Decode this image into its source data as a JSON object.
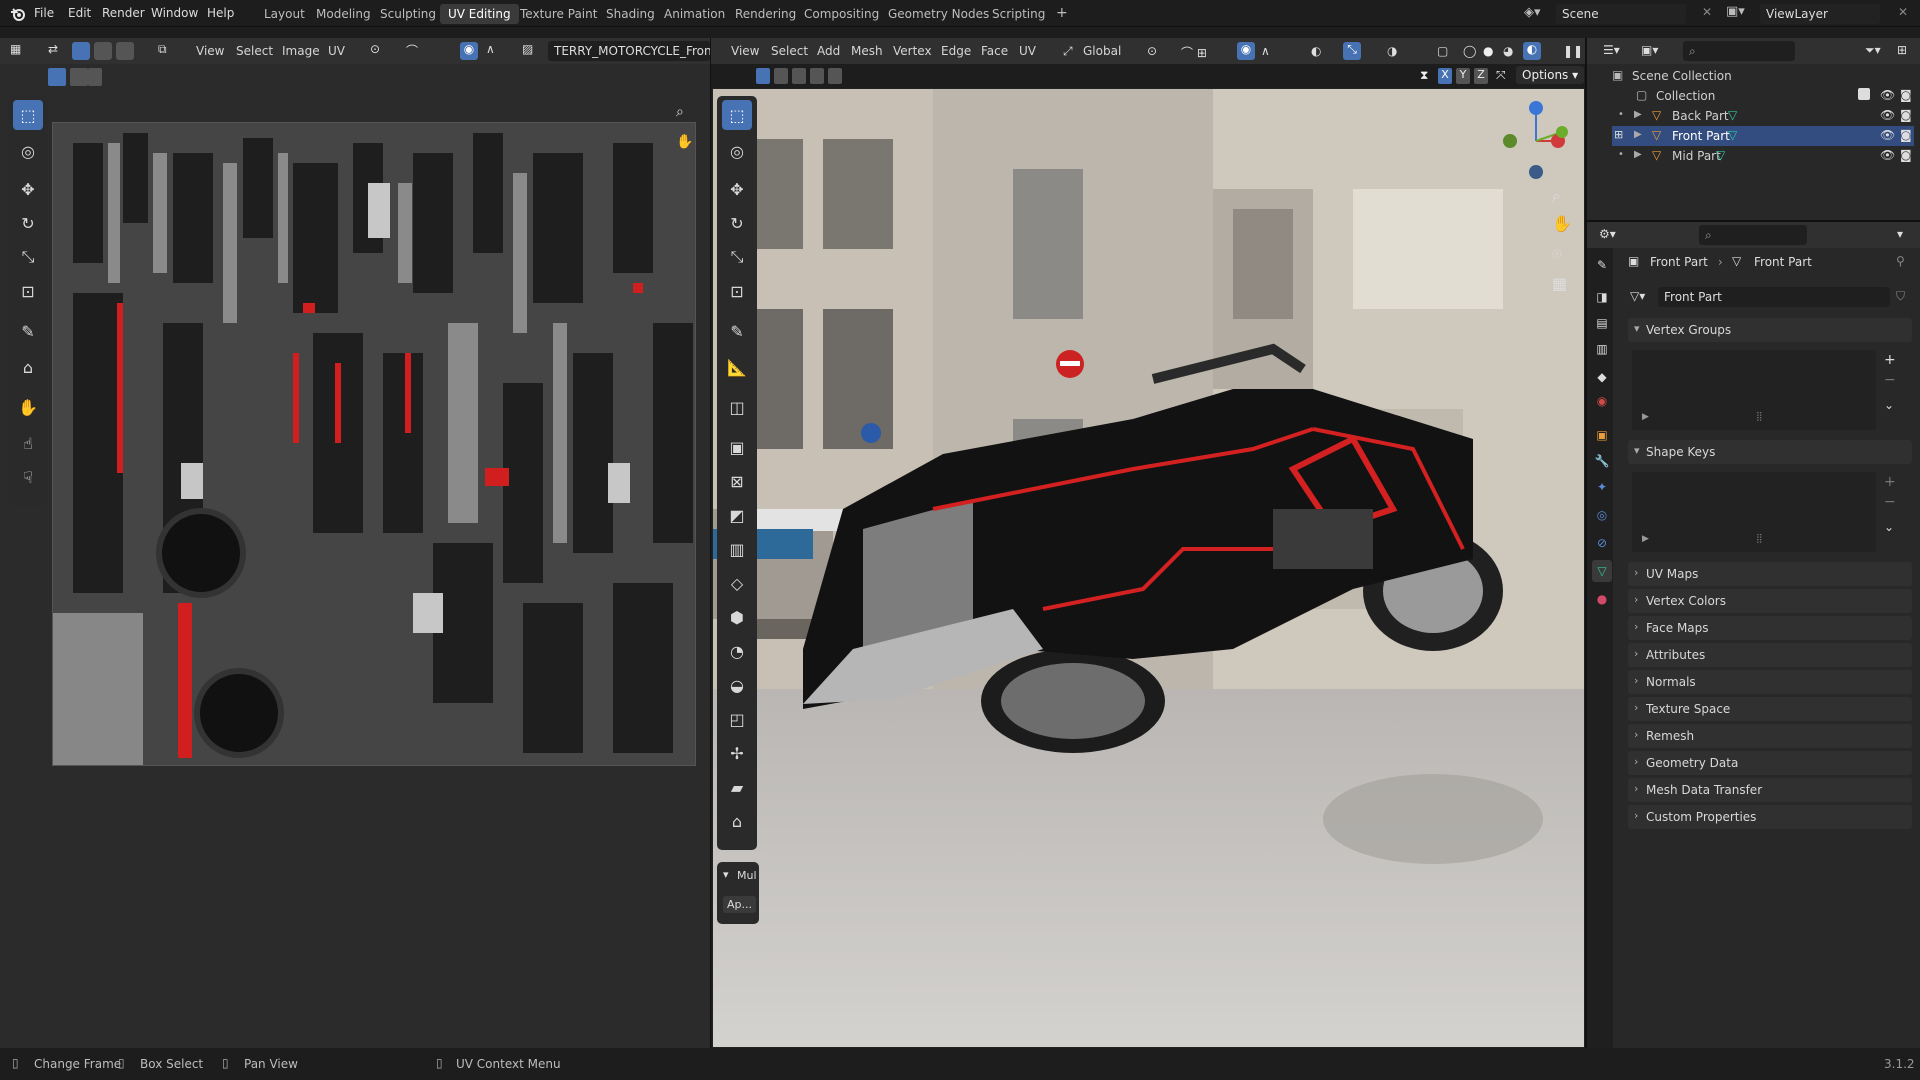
{
  "menus": [
    "File",
    "Edit",
    "Render",
    "Window",
    "Help"
  ],
  "workspaces": [
    "Layout",
    "Modeling",
    "Sculpting",
    "UV Editing",
    "Texture Paint",
    "Shading",
    "Animation",
    "Rendering",
    "Compositing",
    "Geometry Nodes",
    "Scripting"
  ],
  "active_workspace": "UV Editing",
  "scene_name": "Scene",
  "view_layer": "ViewLayer",
  "uv_editor": {
    "menus": [
      "View",
      "Select",
      "Image",
      "UV"
    ],
    "image_name": "TERRY_MOTORCYCLE_Front Pa"
  },
  "viewport": {
    "menus": [
      "View",
      "Select",
      "Add",
      "Mesh",
      "Vertex",
      "Edge",
      "Face",
      "UV"
    ],
    "transform_orientation": "Global",
    "axis_labels": [
      "X",
      "Y",
      "Z"
    ],
    "options_label": "Options",
    "last_op_label": "Mul",
    "last_op_button": "Ap..."
  },
  "outliner": {
    "scene_collection": "Scene Collection",
    "collection": "Collection",
    "items": [
      {
        "label": "Back Part",
        "selected": false
      },
      {
        "label": "Front Part",
        "selected": true
      },
      {
        "label": "Mid Part",
        "selected": false
      }
    ]
  },
  "properties": {
    "breadcrumb_object": "Front Part",
    "breadcrumb_data": "Front Part",
    "mesh_name": "Front Part",
    "vertex_groups": "Vertex Groups",
    "shape_keys": "Shape Keys",
    "panels": [
      "UV Maps",
      "Vertex Colors",
      "Face Maps",
      "Attributes",
      "Normals",
      "Texture Space",
      "Remesh",
      "Geometry Data",
      "Mesh Data Transfer",
      "Custom Properties"
    ]
  },
  "status": {
    "change_frame": "Change Frame",
    "box_select": "Box Select",
    "pan_view": "Pan View",
    "uv_context_menu": "UV Context Menu",
    "version": "3.1.2"
  },
  "colors": {
    "accent": "#4772b3",
    "selected_row": "#334d80",
    "mesh_data_icon": "#2fc7a0",
    "object_icon": "#e89c3a"
  }
}
